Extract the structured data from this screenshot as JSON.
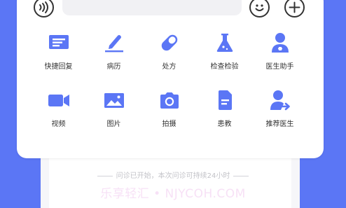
{
  "colors": {
    "accent": "#5B76F5",
    "icon": "#5B76F5",
    "panel": "#FFFFFF"
  },
  "background": {
    "notice": "问诊已开始，本次问诊可持续24小时",
    "watermark": "乐享轻汇 • NJYCOH.COM"
  },
  "input_bar": {
    "voice_icon": "voice-icon",
    "emoji_icon": "emoji-icon",
    "plus_icon": "plus-icon"
  },
  "actions": [
    {
      "label": "快捷回复",
      "icon": "quick-reply-icon"
    },
    {
      "label": "病历",
      "icon": "medical-record-icon"
    },
    {
      "label": "处方",
      "icon": "prescription-icon"
    },
    {
      "label": "检查检验",
      "icon": "lab-test-icon"
    },
    {
      "label": "医生助手",
      "icon": "doctor-assistant-icon"
    },
    {
      "label": "视频",
      "icon": "video-icon"
    },
    {
      "label": "图片",
      "icon": "image-icon"
    },
    {
      "label": "拍摄",
      "icon": "camera-icon"
    },
    {
      "label": "患教",
      "icon": "patient-education-icon"
    },
    {
      "label": "推荐医生",
      "icon": "recommend-doctor-icon"
    }
  ]
}
